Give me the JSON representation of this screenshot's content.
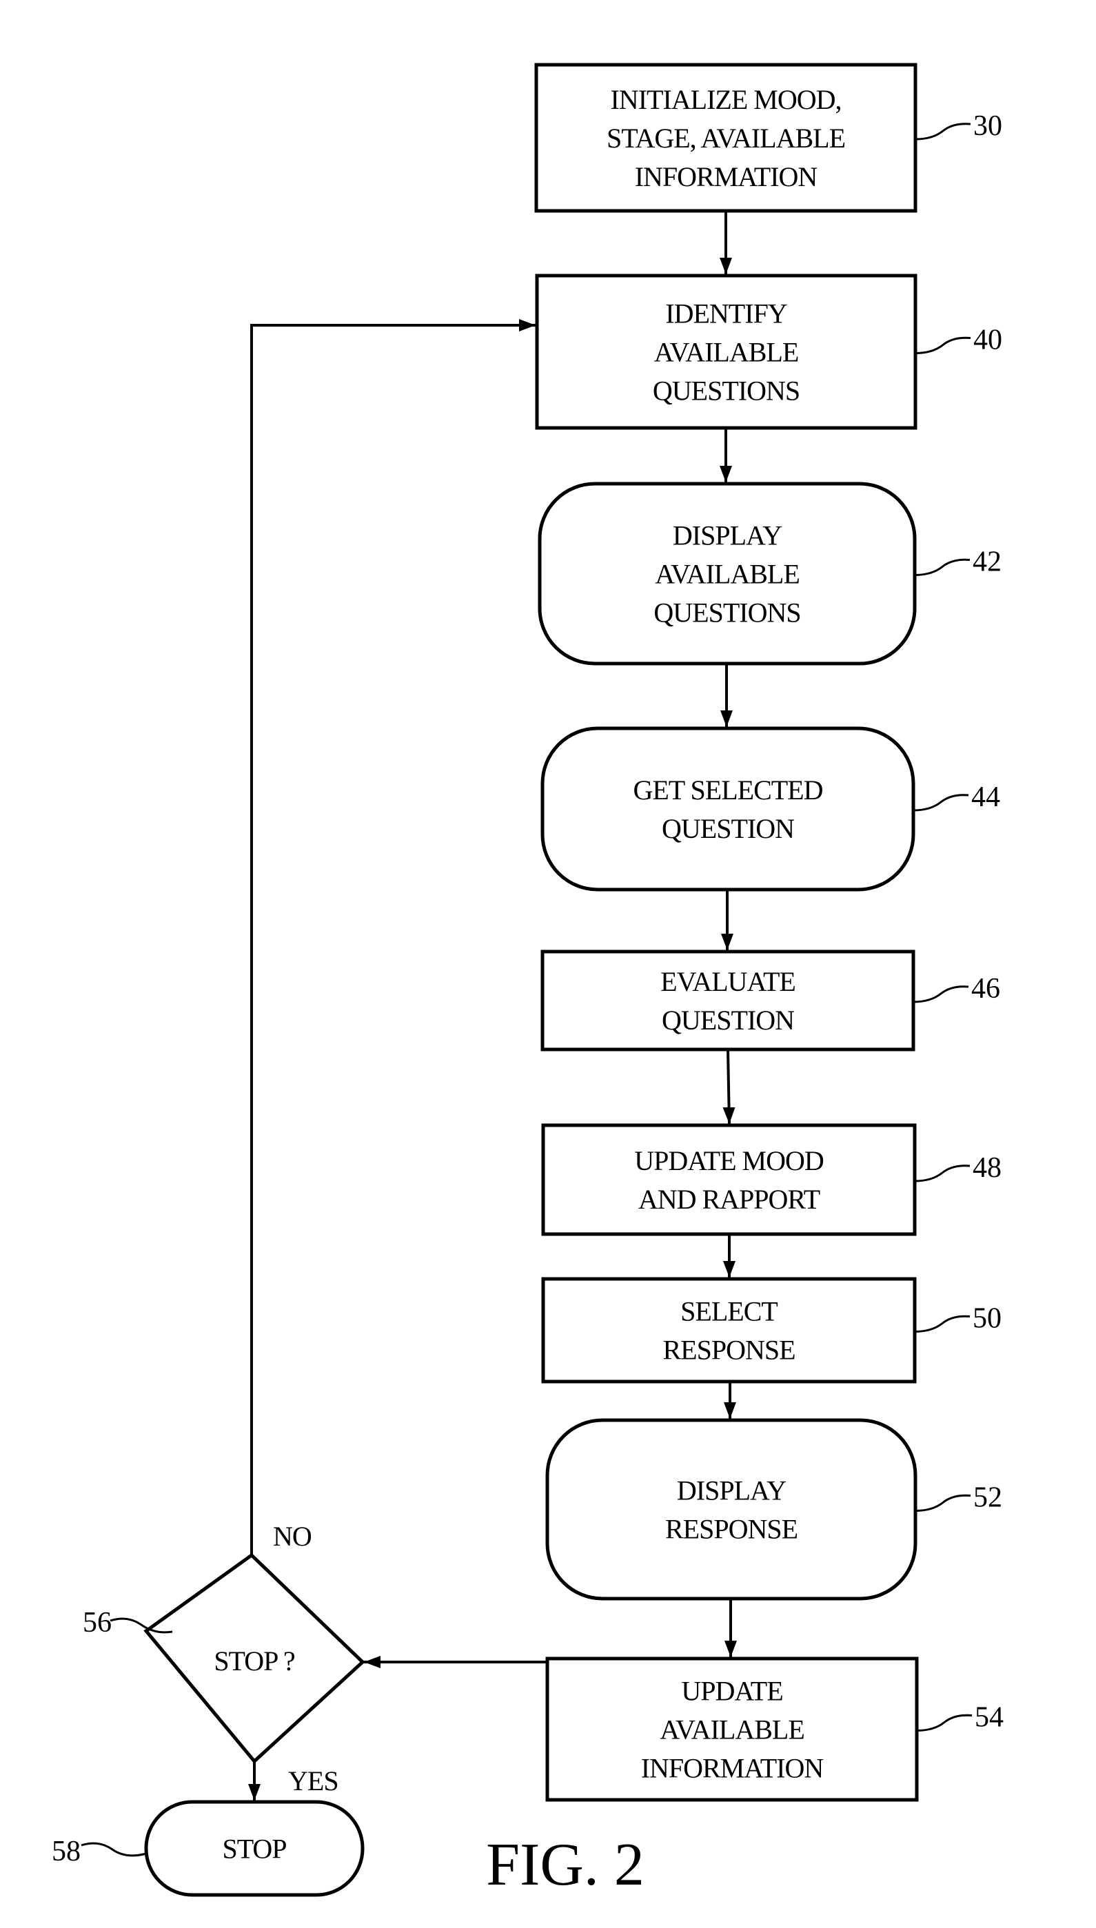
{
  "figure": {
    "caption": "FIG. 2",
    "nodes": [
      {
        "id": "30",
        "shape": "rect",
        "lines": [
          "INITIALIZE MOOD,",
          "STAGE, AVAILABLE",
          "INFORMATION"
        ]
      },
      {
        "id": "40",
        "shape": "rect",
        "lines": [
          "IDENTIFY",
          "AVAILABLE",
          "QUESTIONS"
        ]
      },
      {
        "id": "42",
        "shape": "rounded",
        "lines": [
          "DISPLAY",
          "AVAILABLE",
          "QUESTIONS"
        ]
      },
      {
        "id": "44",
        "shape": "rounded",
        "lines": [
          "GET SELECTED",
          "QUESTION"
        ]
      },
      {
        "id": "46",
        "shape": "rect",
        "lines": [
          "EVALUATE",
          "QUESTION"
        ]
      },
      {
        "id": "48",
        "shape": "rect",
        "lines": [
          "UPDATE MOOD",
          "AND RAPPORT"
        ]
      },
      {
        "id": "50",
        "shape": "rect",
        "lines": [
          "SELECT",
          "RESPONSE"
        ]
      },
      {
        "id": "52",
        "shape": "rounded",
        "lines": [
          "DISPLAY",
          "RESPONSE"
        ]
      },
      {
        "id": "54",
        "shape": "rect",
        "lines": [
          "UPDATE",
          "AVAILABLE",
          "INFORMATION"
        ]
      },
      {
        "id": "56",
        "shape": "diamond",
        "lines": [
          "STOP ?"
        ]
      },
      {
        "id": "58",
        "shape": "terminal",
        "lines": [
          "STOP"
        ]
      }
    ],
    "edges": [
      {
        "from": "30",
        "to": "40"
      },
      {
        "from": "40",
        "to": "42"
      },
      {
        "from": "42",
        "to": "44"
      },
      {
        "from": "44",
        "to": "46"
      },
      {
        "from": "46",
        "to": "48"
      },
      {
        "from": "48",
        "to": "50"
      },
      {
        "from": "50",
        "to": "52"
      },
      {
        "from": "52",
        "to": "54"
      },
      {
        "from": "54",
        "to": "56"
      },
      {
        "from": "56",
        "to": "40",
        "label": "NO"
      },
      {
        "from": "56",
        "to": "58",
        "label": "YES"
      }
    ],
    "branch_labels": {
      "no": "NO",
      "yes": "YES"
    }
  }
}
